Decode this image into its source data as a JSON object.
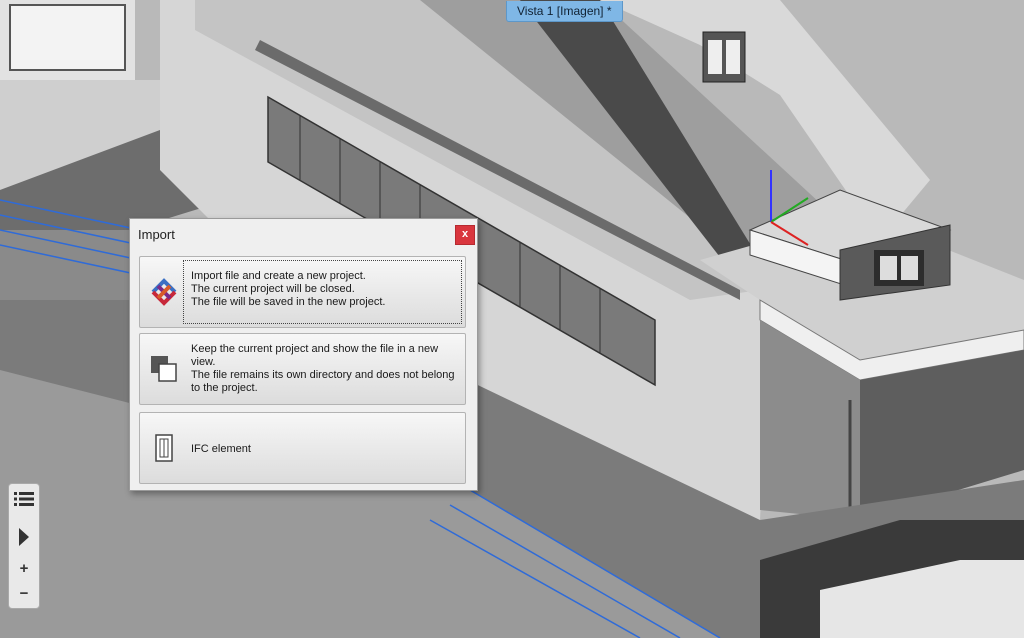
{
  "view_tab": {
    "label": "Vista 1 [Imagen] *"
  },
  "dialog": {
    "title": "Import",
    "close_label": "x",
    "options": [
      {
        "icon": "ifc-logo-icon",
        "lines": [
          "Import file and create a new project.",
          "The current project will be closed.",
          " The file will be saved in the new project."
        ]
      },
      {
        "icon": "new-view-icon",
        "lines": [
          "Keep the current project and show the file in a new",
          "view.",
          "The file remains its own directory and does not belong",
          "to the project."
        ]
      },
      {
        "icon": "ifc-element-icon",
        "lines": [
          "IFC element"
        ]
      }
    ]
  },
  "nav": {
    "menu_icon": "list-menu-icon",
    "play_icon": "play-icon",
    "zoom_in_label": "+",
    "zoom_out_label": "−"
  }
}
